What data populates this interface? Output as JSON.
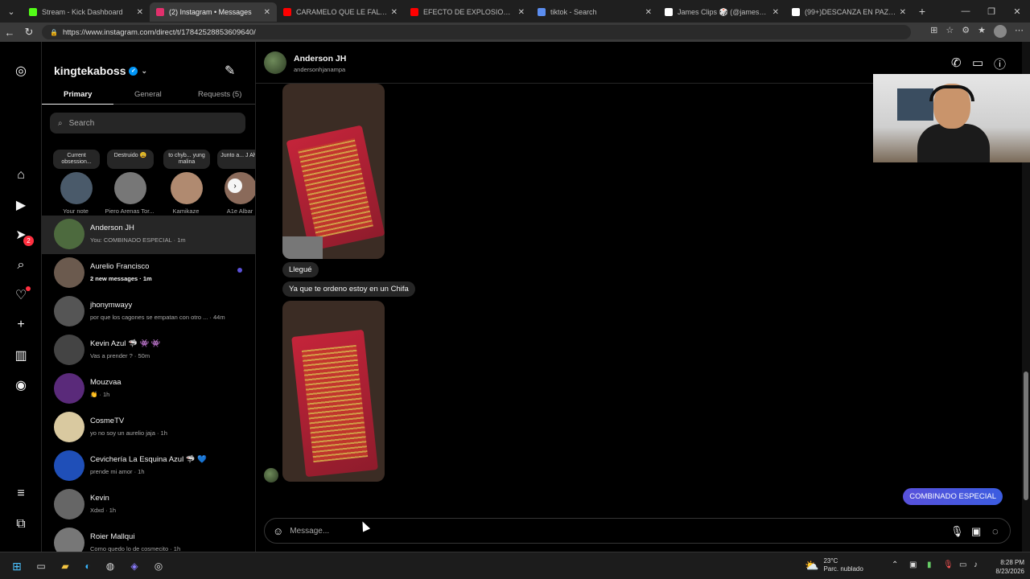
{
  "browser": {
    "tabs": [
      {
        "title": "Stream - Kick Dashboard",
        "color": "#53fc18",
        "active": false
      },
      {
        "title": "(2) Instagram • Messages",
        "color": "#e1306c",
        "active": true
      },
      {
        "title": "CARAMELO QUE LE FALTA A TU P...",
        "color": "#ff0000",
        "active": false
      },
      {
        "title": "EFECTO DE EXPLOSION (DJ) - You...",
        "color": "#ff0000",
        "active": false
      },
      {
        "title": "tiktok - Search",
        "color": "#5b8def",
        "active": false
      },
      {
        "title": "James Clips 🎲 (@jamesclipsdota...",
        "color": "#ffffff",
        "active": false
      },
      {
        "title": "(99+)DESCANZA EN PAZ AMIGO...",
        "color": "#ffffff",
        "active": false
      }
    ],
    "url": "https://www.instagram.com/direct/t/17842528853609640/"
  },
  "inbox": {
    "username": "kingtekaboss",
    "tabs": {
      "primary": "Primary",
      "general": "General",
      "requests": "Requests (5)"
    },
    "search_placeholder": "Search",
    "notes": [
      {
        "bubble": "Current obsession...",
        "name": "Your note",
        "color": "#4a5a6a"
      },
      {
        "bubble": "Destruido 😩",
        "name": "Piero Arenas Tor...",
        "color": "#777777"
      },
      {
        "bubble": "to chyb... yung malina",
        "name": "Kamikaze",
        "color": "#b08a70"
      },
      {
        "bubble": "Junto a... J Alva",
        "name": "A1e Albar",
        "color": "#8a6a5a"
      }
    ],
    "conversations": [
      {
        "name": "Anderson JH",
        "preview": "You: COMBINADO ESPECIAL · 1m",
        "color": "#4d6a3e",
        "selected": true
      },
      {
        "name": "Aurelio Francisco",
        "preview": "2 new messages · 1m",
        "color": "#6b5a4e",
        "unread": true
      },
      {
        "name": "jhonymwayy",
        "preview": "por que los cagones se empatan con otro ... · 44m",
        "color": "#555555"
      },
      {
        "name": "Kevin Azul 🦈 👾 👾",
        "preview": "Vas a prender ? · 50m",
        "color": "#444444"
      },
      {
        "name": "Mouzvaa",
        "preview": "👏 · 1h",
        "color": "#5a2a7a"
      },
      {
        "name": "CosmeTV",
        "preview": "yo no soy un aurelio jaja · 1h",
        "color": "#d9c9a0"
      },
      {
        "name": "Cevichería La Esquina Azul 🦈 💙",
        "preview": "prende mi amor · 1h",
        "color": "#1f4fb8"
      },
      {
        "name": "Kevin",
        "preview": "Xdxd · 1h",
        "color": "#666666"
      },
      {
        "name": "Roier Mallqui",
        "preview": "Como quedo lo de cosmecito · 1h",
        "color": "#777777"
      }
    ]
  },
  "chat": {
    "name": "Anderson JH",
    "handle": "andersonhjanampa",
    "messages": {
      "m1": "Llegué",
      "m2": "Ya que te ordeno estoy en un Chifa",
      "sent": "COMBINADO ESPECIAL"
    },
    "composer_placeholder": "Message..."
  },
  "taskbar": {
    "temp": "23°C",
    "weather": "Parc. nublado",
    "time": "8:28 PM",
    "date": "8/23/2026"
  },
  "rail": {
    "messages_badge": "2"
  }
}
